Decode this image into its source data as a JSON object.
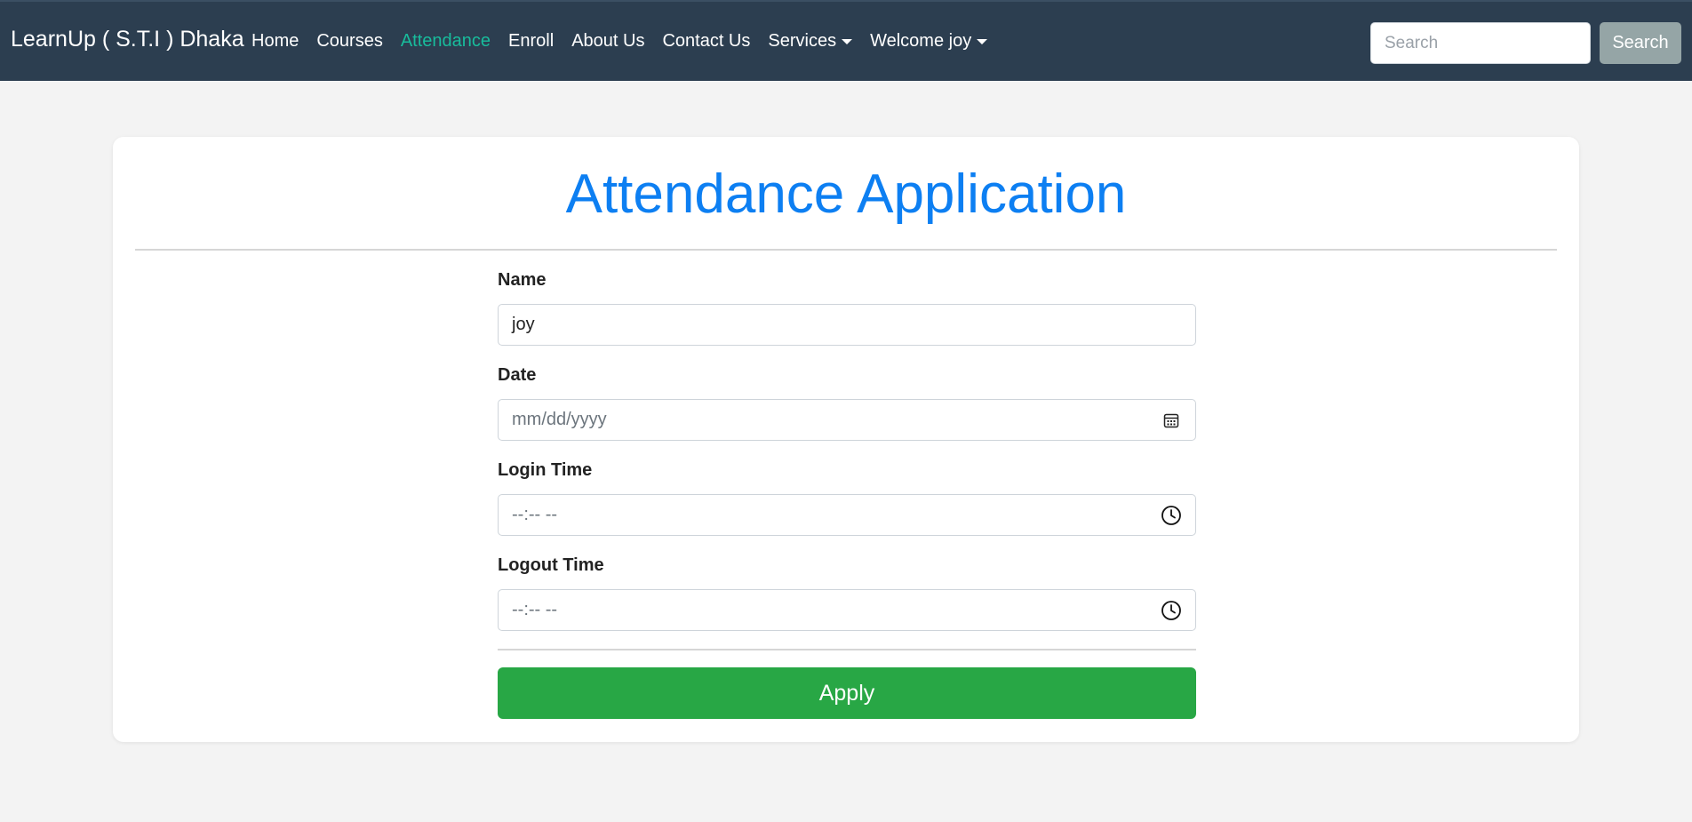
{
  "navbar": {
    "brand": "LearnUp ( S.T.I ) Dhaka",
    "links": [
      {
        "label": "Home",
        "active": false
      },
      {
        "label": "Courses",
        "active": false
      },
      {
        "label": "Attendance",
        "active": true
      },
      {
        "label": "Enroll",
        "active": false
      },
      {
        "label": "About Us",
        "active": false
      },
      {
        "label": "Contact Us",
        "active": false
      },
      {
        "label": "Services",
        "active": false,
        "dropdown": true
      },
      {
        "label": "Welcome joy",
        "active": false,
        "dropdown": true
      }
    ],
    "search": {
      "placeholder": "Search",
      "button_label": "Search"
    }
  },
  "form": {
    "title": "Attendance Application",
    "fields": [
      {
        "label": "Name",
        "value": "joy",
        "placeholder": "",
        "icon": ""
      },
      {
        "label": "Date",
        "value": "",
        "placeholder": "mm/dd/yyyy",
        "icon": "calendar-icon"
      },
      {
        "label": "Login Time",
        "value": "",
        "placeholder": "--:-- --",
        "icon": "clock-icon"
      },
      {
        "label": "Logout Time",
        "value": "",
        "placeholder": "--:-- --",
        "icon": "clock-icon"
      }
    ],
    "submit_label": "Apply"
  },
  "colors": {
    "navbar_bg": "#2c3e50",
    "active_link": "#18bc9c",
    "title": "#0d7ff2",
    "apply_button": "#28a745",
    "search_button": "#95a5a6"
  }
}
